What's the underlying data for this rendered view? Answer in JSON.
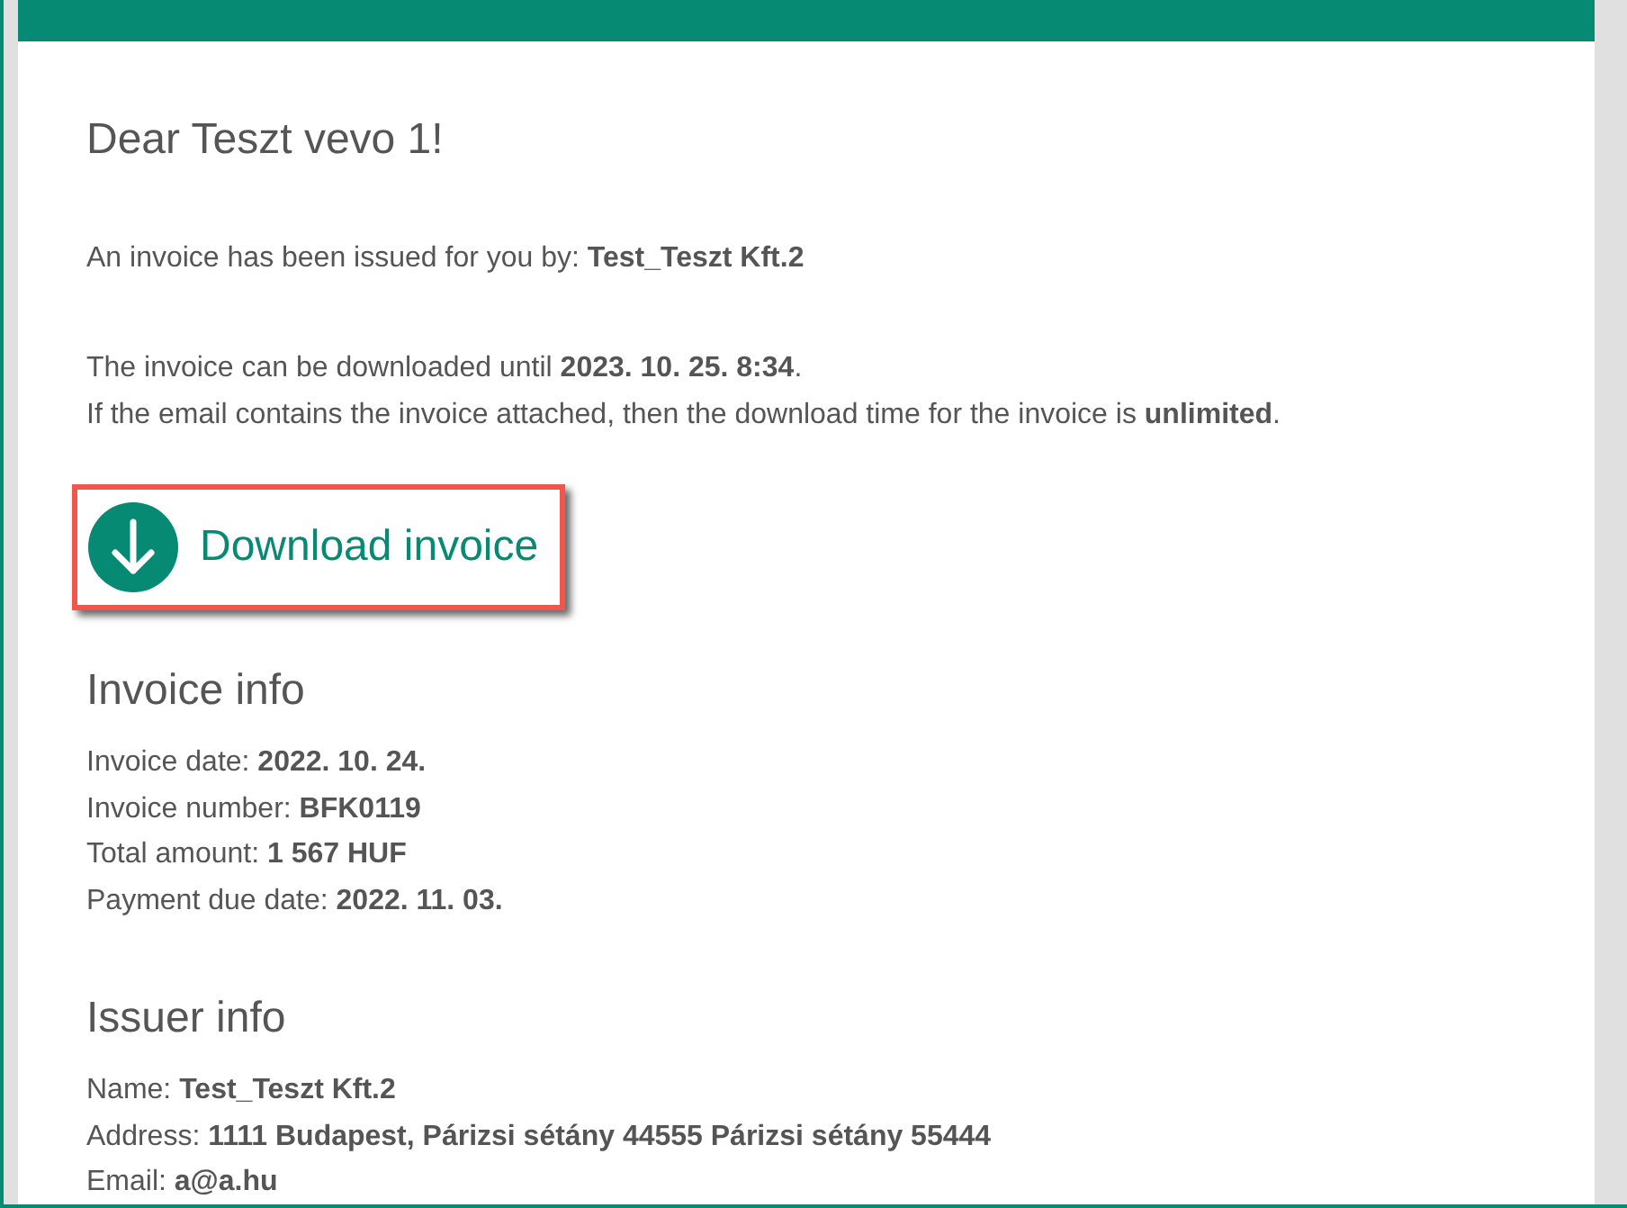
{
  "greeting": "Dear Teszt vevo 1!",
  "issued_by": "An invoice has been issued for you by: **Test_Teszt Kft.2**",
  "download_note": [
    "The invoice can be downloaded until **2023. 10. 25. 8:34**.",
    "If the email contains the invoice attached, then the download time for the invoice is **unlimited**."
  ],
  "download_link": {
    "label": "Download invoice",
    "highlighted": true
  },
  "sections": [
    {
      "title": "Invoice info",
      "lines": [
        "Invoice date: **2022. 10. 24.**",
        "Invoice number: **BFK0119**",
        "Total amount: **1 567 HUF**",
        "Payment due date: **2022. 11. 03.**"
      ]
    },
    {
      "title": "Issuer info",
      "lines": [
        "Name: **Test_Teszt Kft.2**",
        "Address: **1111 Budapest, Párizsi sétány 44555 Párizsi sétány 55444**",
        "Email: **a@a.hu**"
      ]
    }
  ]
}
